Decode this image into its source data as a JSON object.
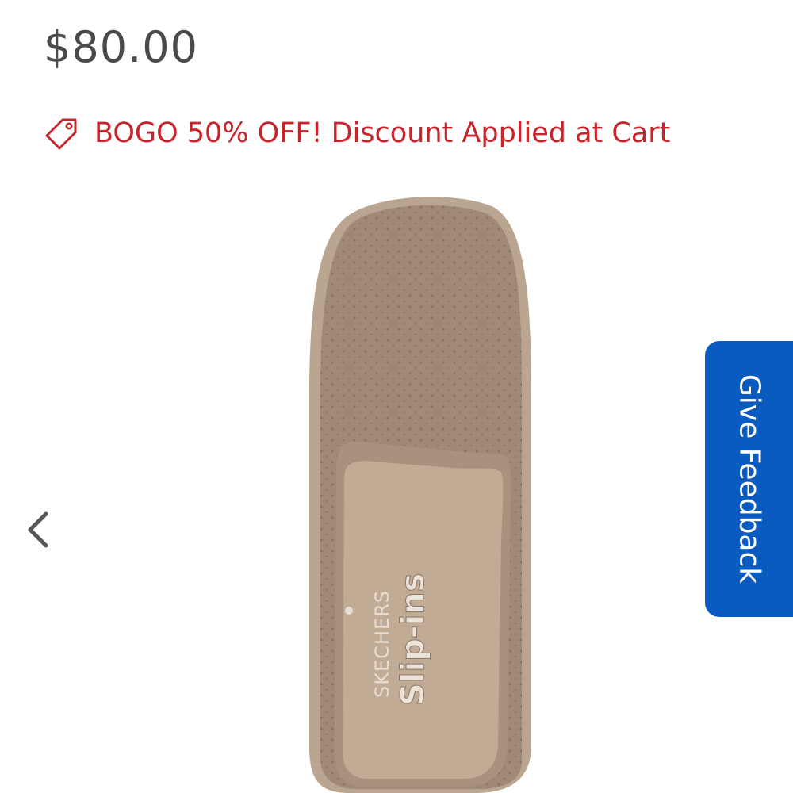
{
  "product": {
    "price": "$80.00"
  },
  "promo": {
    "icon": "tag-icon",
    "text": "BOGO 50% OFF! Discount Applied at Cart",
    "color": "#c8242b"
  },
  "product_image": {
    "brand_text": "SKECHERS",
    "logo_text": "Slip-ins"
  },
  "carousel": {
    "prev_icon": "chevron-left-icon"
  },
  "feedback": {
    "label": "Give Feedback",
    "color": "#0a5bbf"
  }
}
